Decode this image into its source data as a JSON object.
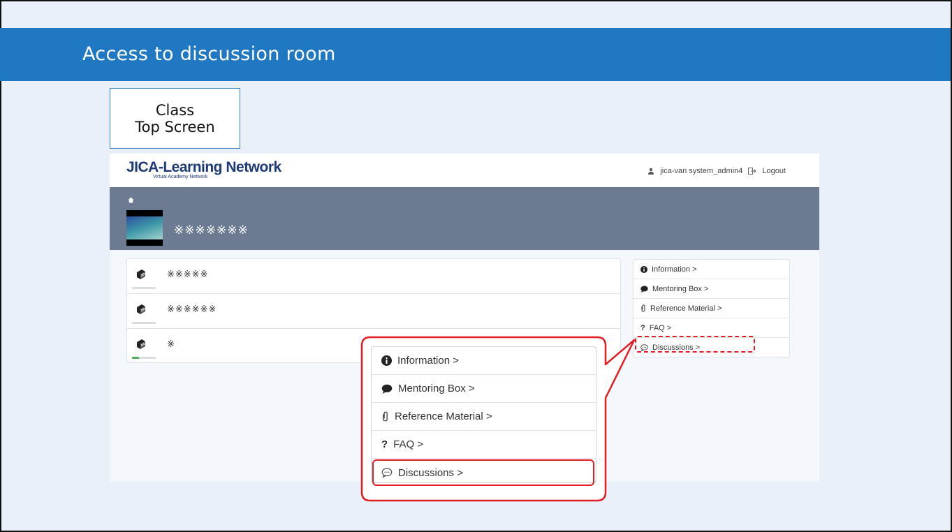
{
  "slide": {
    "title": "Access to discussion room",
    "screen_label_line1": "Class",
    "screen_label_line2": "Top Screen"
  },
  "app": {
    "logo_main": "JICA-Learning Network",
    "logo_sub": "Virtual Academy Network",
    "user_name": "jica-van system_admin4",
    "logout_label": "Logout",
    "course_title": "※※※※※※※"
  },
  "contents": [
    {
      "label": "※※※※※",
      "progress": 0
    },
    {
      "label": "※※※※※※",
      "progress": 0
    },
    {
      "label": "※",
      "progress": 0.3
    }
  ],
  "side_menu": [
    {
      "label": "Information >",
      "icon": "info-icon"
    },
    {
      "label": "Mentoring Box >",
      "icon": "chat-icon"
    },
    {
      "label": "Reference Material >",
      "icon": "paperclip-icon"
    },
    {
      "label": "FAQ >",
      "icon": "question-icon"
    },
    {
      "label": "Discussions >",
      "icon": "discussion-icon"
    }
  ],
  "colors": {
    "banner": "#1f78c1",
    "highlight": "#e31b23",
    "course_band": "#6d7b92",
    "logo": "#1d3a78"
  }
}
